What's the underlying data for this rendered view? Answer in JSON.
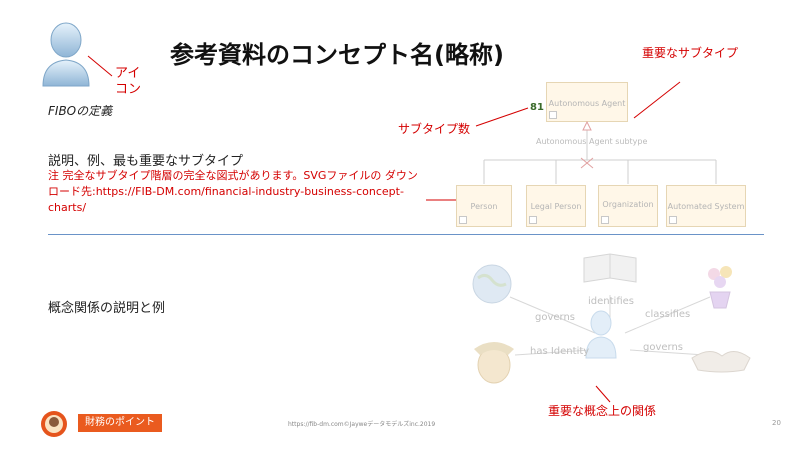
{
  "slide": {
    "title": "参考資料のコンセプト名(略称)",
    "icon_label": "アイコン",
    "fibo_definition": "FIBOの定義",
    "description_heading": "説明、例、最も重要なサブタイプ",
    "note": "注 完全なサブタイプ階層の完全な図式があります。SVGファイルの ダウンロード先:https://FIB-DM.com/financial-industry-business-concept-charts/",
    "subtype_count_label": "サブタイプ数",
    "important_subtypes": "重要なサブタイプ",
    "relation_description": "概念関係の説明と例",
    "important_relations": "重要な概念上の関係"
  },
  "diagram": {
    "subtype_count": "81",
    "root": "Autonomous Agent",
    "caption": "Autonomous Agent subtype",
    "subtypes": [
      "Person",
      "Legal Person",
      "Organization",
      "Automated System"
    ]
  },
  "relations": {
    "identifies": "identifies",
    "governs_left": "governs",
    "classifies": "classifies",
    "has_identity": "has Identity",
    "governs_right": "governs"
  },
  "footer": {
    "badge": "財務のポイント",
    "source": "https://fib-dm.com©Jayweデータモデルズinc.2019",
    "page": "20"
  }
}
